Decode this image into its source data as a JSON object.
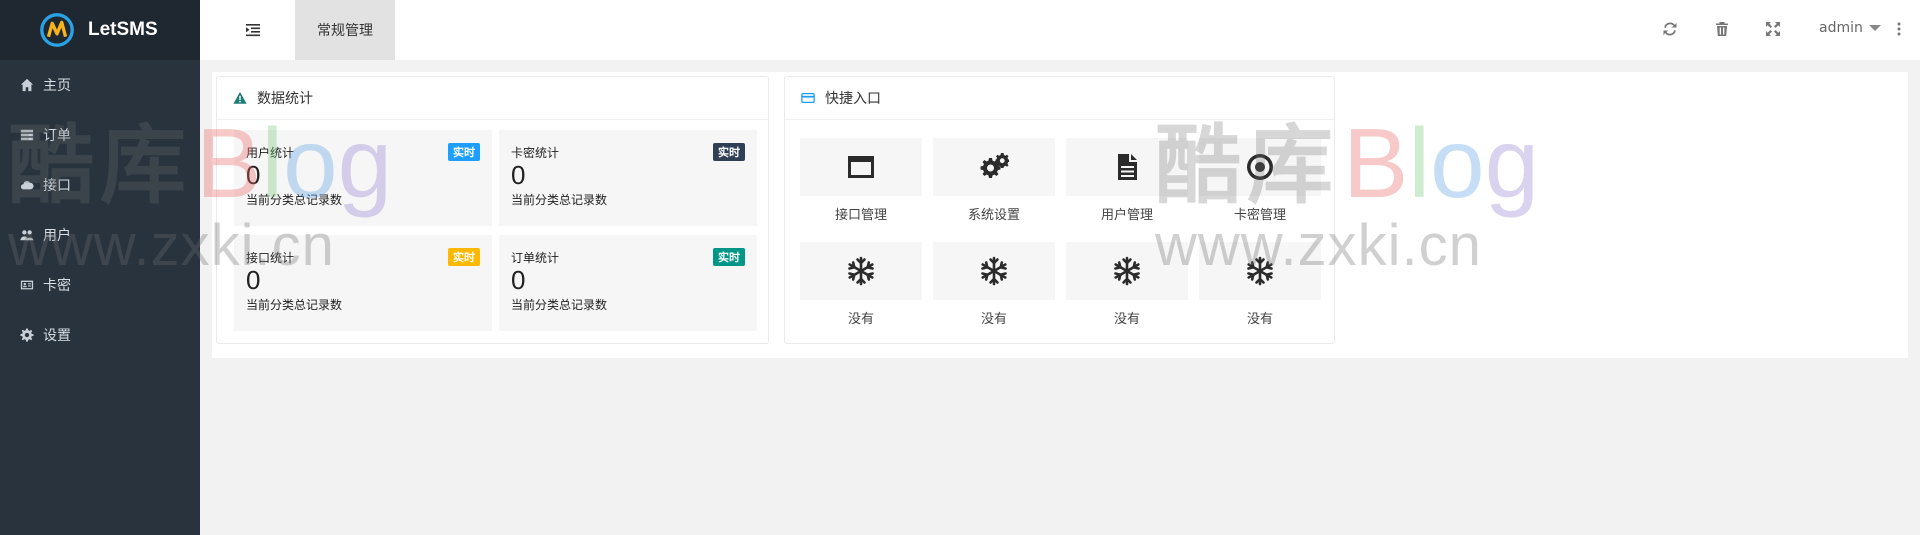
{
  "app": {
    "logo_text": "LetSMS"
  },
  "sidebar": {
    "items": [
      {
        "label": "主页",
        "icon": "home-icon"
      },
      {
        "label": "订单",
        "icon": "list-icon"
      },
      {
        "label": "接口",
        "icon": "cloud-icon"
      },
      {
        "label": "用户",
        "icon": "users-icon"
      },
      {
        "label": "卡密",
        "icon": "id-card-icon"
      },
      {
        "label": "设置",
        "icon": "gear-icon"
      }
    ]
  },
  "header": {
    "active_tab": "常规管理",
    "icons": [
      "refresh-icon",
      "trash-icon",
      "fullscreen-icon",
      "more-vertical-icon"
    ],
    "user": "admin"
  },
  "stats_panel": {
    "title": "数据统计",
    "cards": [
      {
        "title": "用户统计",
        "badge": "实时",
        "badge_color": "#1e9fff",
        "value": "0",
        "desc": "当前分类总记录数"
      },
      {
        "title": "卡密统计",
        "badge": "实时",
        "badge_color": "#2f4056",
        "value": "0",
        "desc": "当前分类总记录数"
      },
      {
        "title": "接口统计",
        "badge": "实时",
        "badge_color": "#ffb800",
        "value": "0",
        "desc": "当前分类总记录数"
      },
      {
        "title": "订单统计",
        "badge": "实时",
        "badge_color": "#009688",
        "value": "0",
        "desc": "当前分类总记录数"
      }
    ]
  },
  "quick_panel": {
    "title": "快捷入口",
    "items": [
      {
        "label": "接口管理",
        "icon": "window-icon"
      },
      {
        "label": "系统设置",
        "icon": "gears-icon"
      },
      {
        "label": "用户管理",
        "icon": "file-icon"
      },
      {
        "label": "卡密管理",
        "icon": "dot-circle-icon"
      },
      {
        "label": "没有",
        "icon": "snowflake-icon"
      },
      {
        "label": "没有",
        "icon": "snowflake-icon"
      },
      {
        "label": "没有",
        "icon": "snowflake-icon"
      },
      {
        "label": "没有",
        "icon": "snowflake-icon"
      }
    ]
  },
  "watermark": {
    "cn": "酷库",
    "latin": "Blog",
    "url": "www.zxki.cn"
  },
  "colors": {
    "sidebar_bg": "#28333e",
    "logo_bar_bg": "#1f2830",
    "page_bg": "#f2f2f2"
  }
}
